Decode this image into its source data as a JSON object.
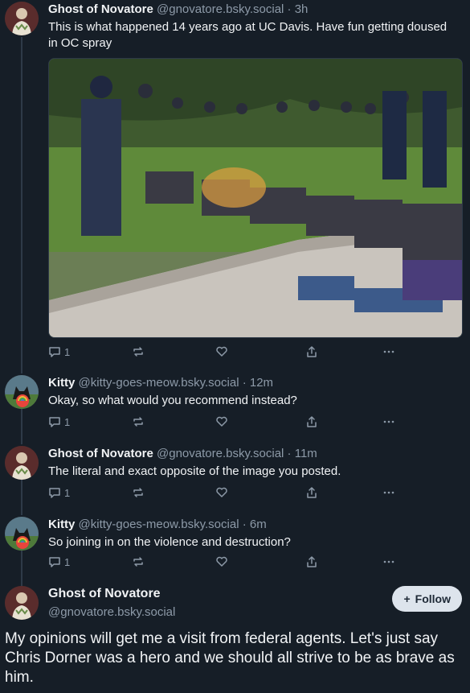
{
  "posts": [
    {
      "name": "Ghost of Novatore",
      "handle": "@gnovatore.bsky.social",
      "time": "· 3h",
      "text": "This is what happened 14 years ago at UC Davis. Have fun getting doused in OC spray",
      "replies": "1",
      "avatar_icon": "portrait-avatar-icon"
    },
    {
      "name": "Kitty",
      "handle": "@kitty-goes-meow.bsky.social",
      "time": "· 12m",
      "text": "Okay, so what would you recommend instead?",
      "replies": "1",
      "avatar_icon": "cat-avatar-icon"
    },
    {
      "name": "Ghost of Novatore",
      "handle": "@gnovatore.bsky.social",
      "time": "· 11m",
      "text": "The literal and exact opposite of the image you posted.",
      "replies": "1",
      "avatar_icon": "portrait-avatar-icon"
    },
    {
      "name": "Kitty",
      "handle": "@kitty-goes-meow.bsky.social",
      "time": "· 6m",
      "text": "So joining in on the violence and destruction?",
      "replies": "1",
      "avatar_icon": "cat-avatar-icon"
    }
  ],
  "focused": {
    "name": "Ghost of Novatore",
    "handle": "@gnovatore.bsky.social",
    "follow_label": "Follow",
    "text": "My opinions will get me a visit from federal agents. Let's just say Chris Dorner was a hero and we should all strive to be as brave as him."
  },
  "colors": {
    "background": "#161e27",
    "muted": "#8d9aa8",
    "follow_bg": "#dde4ec"
  }
}
